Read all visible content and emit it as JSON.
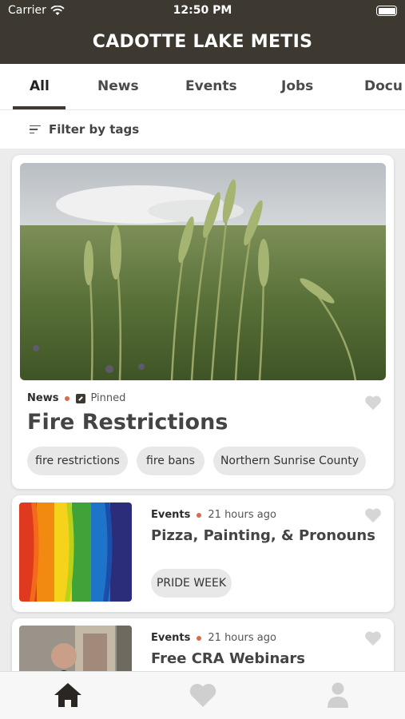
{
  "status": {
    "carrier": "Carrier",
    "time": "12:50 PM"
  },
  "app": {
    "title": "CADOTTE LAKE METIS"
  },
  "tabs": [
    {
      "label": "All"
    },
    {
      "label": "News"
    },
    {
      "label": "Events"
    },
    {
      "label": "Jobs"
    },
    {
      "label": "Docu"
    }
  ],
  "filter": {
    "label": "Filter by tags"
  },
  "posts": [
    {
      "category": "News",
      "pinned_label": "Pinned",
      "title": "Fire Restrictions",
      "tags": [
        "fire restrictions",
        "fire bans",
        "Northern Sunrise County"
      ]
    },
    {
      "category": "Events",
      "time": "21 hours ago",
      "title": "Pizza, Painting, & Pronouns",
      "tags": [
        "PRIDE WEEK"
      ]
    },
    {
      "category": "Events",
      "time": "21 hours ago",
      "title": "Free CRA Webinars",
      "tags": []
    }
  ],
  "nav": {
    "items": [
      "home-icon",
      "heart-icon",
      "profile-icon"
    ]
  },
  "colors": {
    "header": "#3d3830",
    "accent_dot": "#d96b4a"
  }
}
